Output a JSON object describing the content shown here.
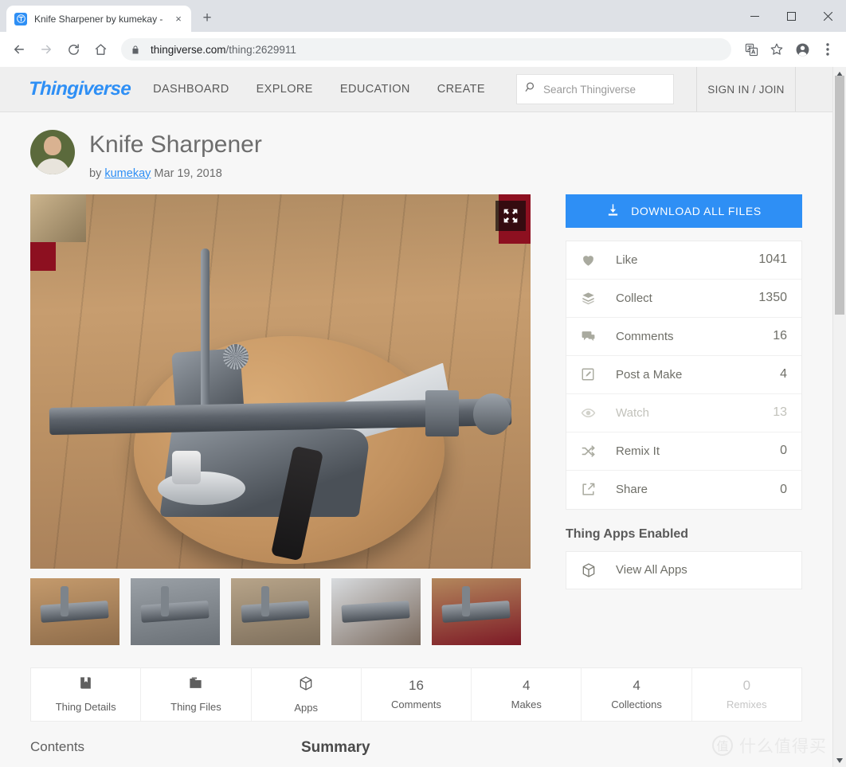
{
  "browser": {
    "tab": {
      "title": "Knife Sharpener by kumekay -",
      "favicon": "thingiverse-favicon",
      "close": "×"
    },
    "new_tab": "+",
    "window_controls": {
      "minimize": "–",
      "maximize": "□",
      "close": "✕"
    },
    "nav": {
      "back": "←",
      "forward": "→",
      "reload": "↻",
      "home": "⌂"
    },
    "omnibox": {
      "lock_icon": "lock-icon",
      "url_domain": "thingiverse.com",
      "url_path": "/thing:2629911"
    },
    "toolbar_icons": [
      "translate-icon",
      "bookmark-star-icon",
      "profile-avatar-icon",
      "overflow-menu-icon"
    ]
  },
  "site_header": {
    "logo": "Thingiverse",
    "nav_links": [
      "DASHBOARD",
      "EXPLORE",
      "EDUCATION",
      "CREATE"
    ],
    "search": {
      "placeholder": "Search Thingiverse",
      "value": "",
      "icon": "search-icon"
    },
    "sign_in": "SIGN IN / JOIN",
    "brand_color": "#2e8ff5"
  },
  "thing": {
    "title": "Knife Sharpener",
    "by_prefix": "by",
    "author": "kumekay",
    "date": "Mar 19, 2018",
    "expand_icon": "expand-arrows-icon"
  },
  "download": {
    "label": "DOWNLOAD ALL FILES",
    "icon": "download-icon",
    "color": "#2e8ff5"
  },
  "stats": [
    {
      "icon": "heart-icon",
      "label": "Like",
      "value": "1041",
      "muted": false
    },
    {
      "icon": "collection-icon",
      "label": "Collect",
      "value": "1350",
      "muted": false
    },
    {
      "icon": "comment-icon",
      "label": "Comments",
      "value": "16",
      "muted": false
    },
    {
      "icon": "pencil-square-icon",
      "label": "Post a Make",
      "value": "4",
      "muted": false
    },
    {
      "icon": "eye-icon",
      "label": "Watch",
      "value": "13",
      "muted": true
    },
    {
      "icon": "shuffle-icon",
      "label": "Remix It",
      "value": "0",
      "muted": false
    },
    {
      "icon": "share-icon",
      "label": "Share",
      "value": "0",
      "muted": false
    }
  ],
  "thing_apps": {
    "heading": "Thing Apps Enabled",
    "item_label": "View All Apps",
    "item_icon": "cube-icon"
  },
  "tabs": [
    {
      "icon": "book-icon",
      "num": "",
      "label": "Thing Details",
      "dim": false
    },
    {
      "icon": "folder-icon",
      "num": "",
      "label": "Thing Files",
      "dim": false
    },
    {
      "icon": "cube-icon",
      "num": "",
      "label": "Apps",
      "dim": false
    },
    {
      "icon": "",
      "num": "16",
      "label": "Comments",
      "dim": false
    },
    {
      "icon": "",
      "num": "4",
      "label": "Makes",
      "dim": false
    },
    {
      "icon": "",
      "num": "4",
      "label": "Collections",
      "dim": false
    },
    {
      "icon": "",
      "num": "0",
      "label": "Remixes",
      "dim": true
    }
  ],
  "sections": {
    "contents": "Contents",
    "summary": "Summary"
  },
  "watermark": {
    "badge": "值",
    "text": "什么值得买"
  }
}
